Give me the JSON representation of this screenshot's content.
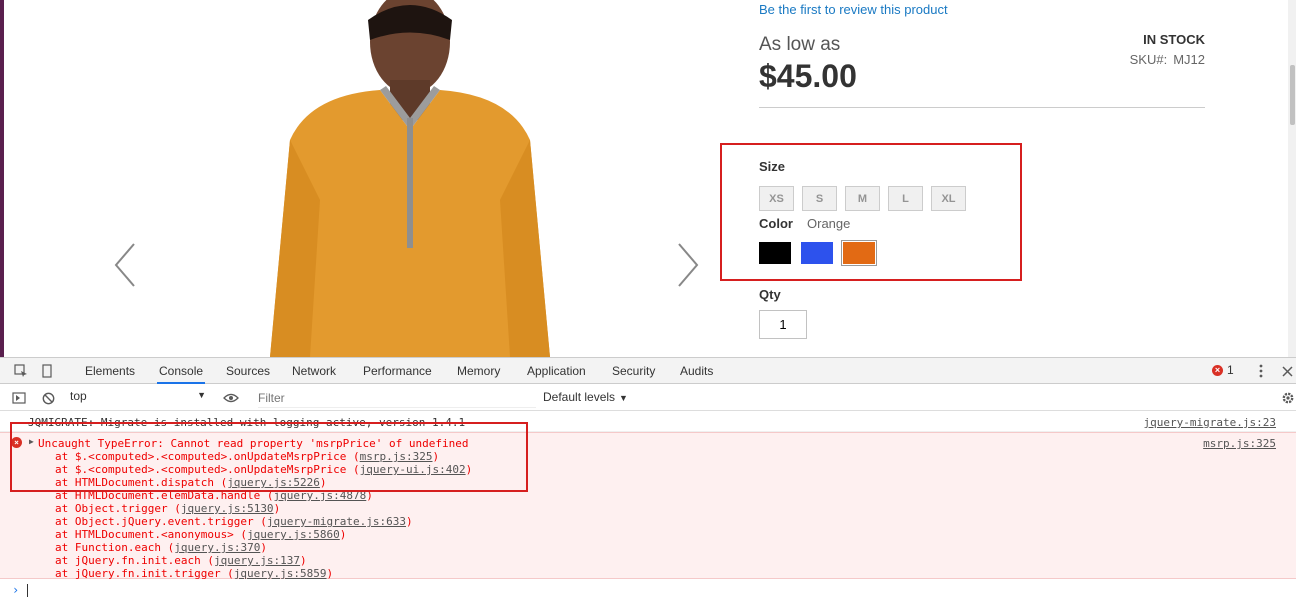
{
  "product": {
    "review_link": "Be the first to review this product",
    "as_low_as": "As low as",
    "price": "$45.00",
    "stock": "IN STOCK",
    "sku_label": "SKU#:",
    "sku_value": "MJ12",
    "size_label": "Size",
    "sizes": [
      "XS",
      "S",
      "M",
      "L",
      "XL"
    ],
    "color_label": "Color",
    "color_value": "Orange",
    "swatches": [
      {
        "name": "Black",
        "color": "#000000"
      },
      {
        "name": "Blue",
        "color": "#2d52ed"
      },
      {
        "name": "Orange",
        "color": "#e26a14"
      }
    ],
    "qty_label": "Qty",
    "qty_value": "1",
    "shirt_color": "#e39a2e"
  },
  "devtools": {
    "tabs": [
      "Elements",
      "Console",
      "Sources",
      "Network",
      "Performance",
      "Memory",
      "Application",
      "Security",
      "Audits"
    ],
    "active_tab": "Console",
    "error_count": "1",
    "context": "top",
    "filter_placeholder": "Filter",
    "levels": "Default levels",
    "log": {
      "text": "JQMIGRATE: Migrate is installed with logging active, version 1.4.1",
      "source": "jquery-migrate.js:23"
    },
    "error": {
      "message": "Uncaught TypeError: Cannot read property 'msrpPrice' of undefined",
      "source": "msrp.js:325",
      "stack": [
        {
          "prefix": "at $.<computed>.<computed>.onUpdateMsrpPrice (",
          "file": "msrp.js:325",
          "suffix": ")"
        },
        {
          "prefix": "at $.<computed>.<computed>.onUpdateMsrpPrice (",
          "file": "jquery-ui.js:402",
          "suffix": ")"
        },
        {
          "prefix": "at HTMLDocument.dispatch (",
          "file": "jquery.js:5226",
          "suffix": ")"
        },
        {
          "prefix": "at HTMLDocument.elemData.handle (",
          "file": "jquery.js:4878",
          "suffix": ")"
        },
        {
          "prefix": "at Object.trigger (",
          "file": "jquery.js:5130",
          "suffix": ")"
        },
        {
          "prefix": "at Object.jQuery.event.trigger (",
          "file": "jquery-migrate.js:633",
          "suffix": ")"
        },
        {
          "prefix": "at HTMLDocument.<anonymous> (",
          "file": "jquery.js:5860",
          "suffix": ")"
        },
        {
          "prefix": "at Function.each (",
          "file": "jquery.js:370",
          "suffix": ")"
        },
        {
          "prefix": "at jQuery.fn.init.each (",
          "file": "jquery.js:137",
          "suffix": ")"
        },
        {
          "prefix": "at jQuery.fn.init.trigger (",
          "file": "jquery.js:5859",
          "suffix": ")"
        }
      ]
    }
  }
}
